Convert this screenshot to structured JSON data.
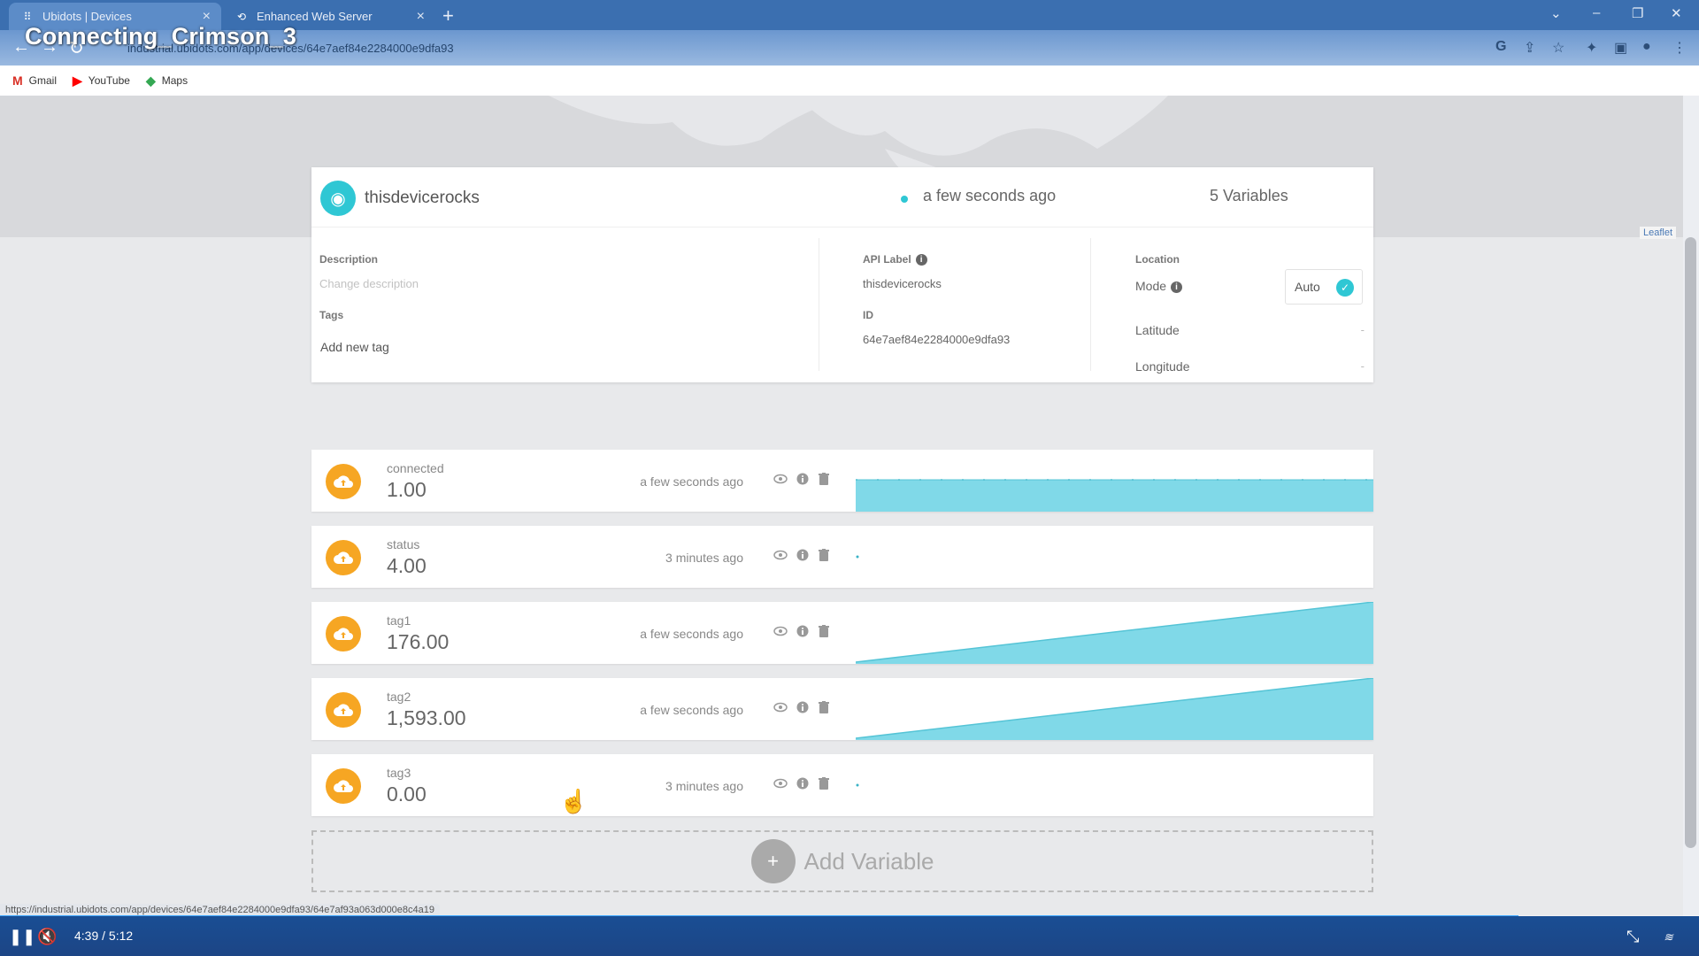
{
  "overlay_title": "Connecting_Crimson_3",
  "browser": {
    "tabs": [
      {
        "title": "Ubidots | Devices",
        "icon": "ubidots-icon",
        "active": true
      },
      {
        "title": "Enhanced Web Server",
        "icon": "link-icon",
        "active": false
      }
    ],
    "url": "industrial.ubidots.com/app/devices/64e7aef84e2284000e9dfa93",
    "bookmarks": [
      {
        "label": "Gmail",
        "icon": "gmail-icon",
        "color": "#d93025"
      },
      {
        "label": "YouTube",
        "icon": "youtube-icon",
        "color": "#ff0000"
      },
      {
        "label": "Maps",
        "icon": "maps-icon",
        "color": "#34a853"
      }
    ],
    "status_url": "https://industrial.ubidots.com/app/devices/64e7aef84e2284000e9dfa93/64e7af93a063d000e8c4a19"
  },
  "map": {
    "attribution": "Leaflet"
  },
  "device": {
    "name": "thisdevicerocks",
    "last_activity": "a few seconds ago",
    "variables_count": "5 Variables",
    "description_label": "Description",
    "description_placeholder": "Change description",
    "tags_label": "Tags",
    "add_tag": "Add new tag",
    "api_label_label": "API Label",
    "api_label": "thisdevicerocks",
    "id_label": "ID",
    "id": "64e7aef84e2284000e9dfa93",
    "location_label": "Location",
    "mode_label": "Mode",
    "mode_value": "Auto",
    "latitude_label": "Latitude",
    "latitude_value": "-",
    "longitude_label": "Longitude",
    "longitude_value": "-"
  },
  "variables": [
    {
      "name": "connected",
      "value": "1.00",
      "time": "a few seconds ago",
      "trend": "flat-high"
    },
    {
      "name": "status",
      "value": "4.00",
      "time": "3 minutes ago",
      "trend": "single-point"
    },
    {
      "name": "tag1",
      "value": "176.00",
      "time": "a few seconds ago",
      "trend": "rising"
    },
    {
      "name": "tag2",
      "value": "1,593.00",
      "time": "a few seconds ago",
      "trend": "rising"
    },
    {
      "name": "tag3",
      "value": "0.00",
      "time": "3 minutes ago",
      "trend": "single-point"
    }
  ],
  "add_variable": "Add Variable",
  "player": {
    "current_time": "4:39",
    "separator": "/",
    "duration": "5:12",
    "progress_fraction": 0.894
  },
  "colors": {
    "accent": "#2fc7d4",
    "variable_icon": "#f6a623",
    "sparkline": "#80d9e8"
  }
}
